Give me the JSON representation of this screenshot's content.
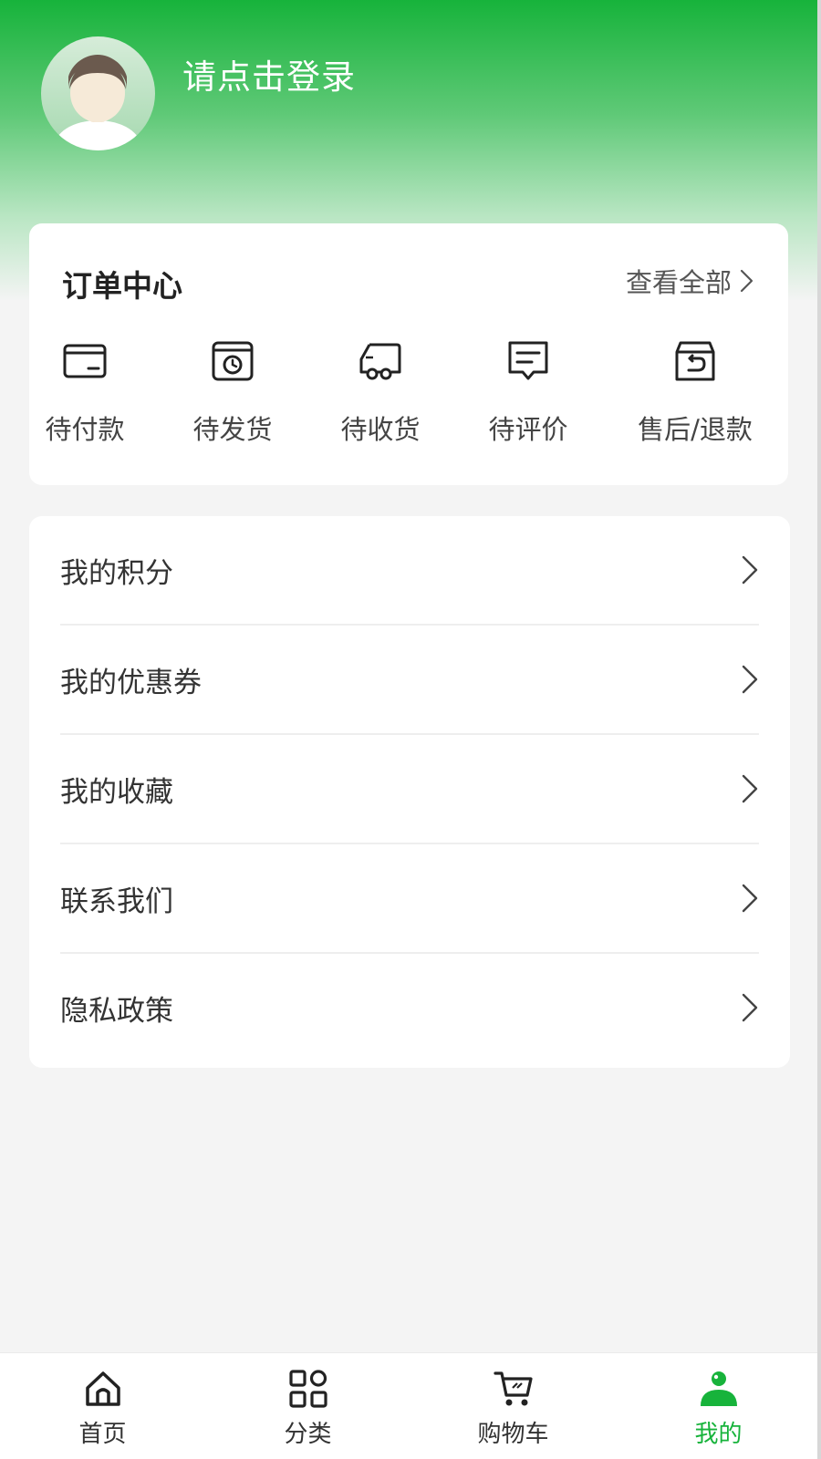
{
  "header": {
    "login_prompt": "请点击登录",
    "gradient_top": "#17b33b"
  },
  "orders": {
    "title": "订单中心",
    "view_all": "查看全部",
    "items": [
      {
        "label": "待付款",
        "icon": "wallet-icon"
      },
      {
        "label": "待发货",
        "icon": "package-clock-icon"
      },
      {
        "label": "待收货",
        "icon": "truck-icon"
      },
      {
        "label": "待评价",
        "icon": "comment-icon"
      },
      {
        "label": "售后/退款",
        "icon": "refund-box-icon"
      }
    ]
  },
  "menu": {
    "items": [
      {
        "label": "我的积分"
      },
      {
        "label": "我的优惠券"
      },
      {
        "label": "我的收藏"
      },
      {
        "label": "联系我们"
      },
      {
        "label": "隐私政策"
      }
    ]
  },
  "tabbar": {
    "active_color": "#17b33b",
    "items": [
      {
        "label": "首页",
        "icon": "home-icon"
      },
      {
        "label": "分类",
        "icon": "category-grid-icon"
      },
      {
        "label": "购物车",
        "icon": "cart-icon"
      },
      {
        "label": "我的",
        "icon": "person-icon",
        "active": true
      }
    ]
  }
}
